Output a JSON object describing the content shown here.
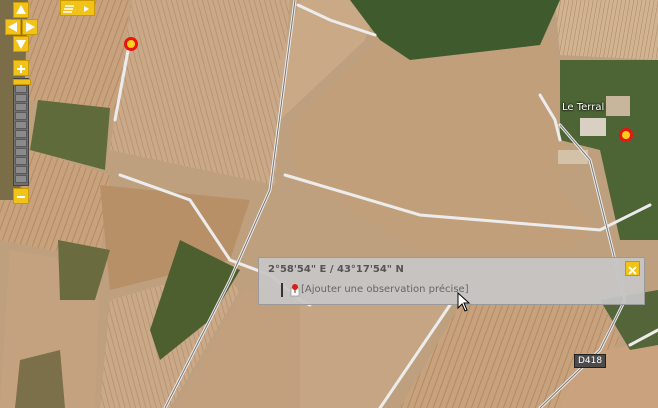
{
  "map": {
    "type": "satellite",
    "place_label": "Le Terral",
    "road_label": "D418"
  },
  "controls": {
    "pan_up_icon": "arrow-up-icon",
    "pan_left_icon": "arrow-left-icon",
    "pan_right_icon": "arrow-right-icon",
    "pan_down_icon": "arrow-down-icon",
    "layers_icon": "layers-icon",
    "zoom_in_label": "+",
    "zoom_out_label": "−",
    "zoom_level_fraction": 0.0
  },
  "markers": [
    {
      "name": "observation-marker",
      "color": "#e8160f"
    },
    {
      "name": "observation-marker",
      "color": "#e8160f"
    }
  ],
  "popup": {
    "coordinates": "2°58'54\" E / 43°17'54\" N",
    "action_link": "[Ajouter une observation précise]",
    "close_icon": "close-icon"
  },
  "colors": {
    "control_yellow": "#f1c21a",
    "marker_red": "#e8160f",
    "marker_fill": "#ffcf1a"
  }
}
